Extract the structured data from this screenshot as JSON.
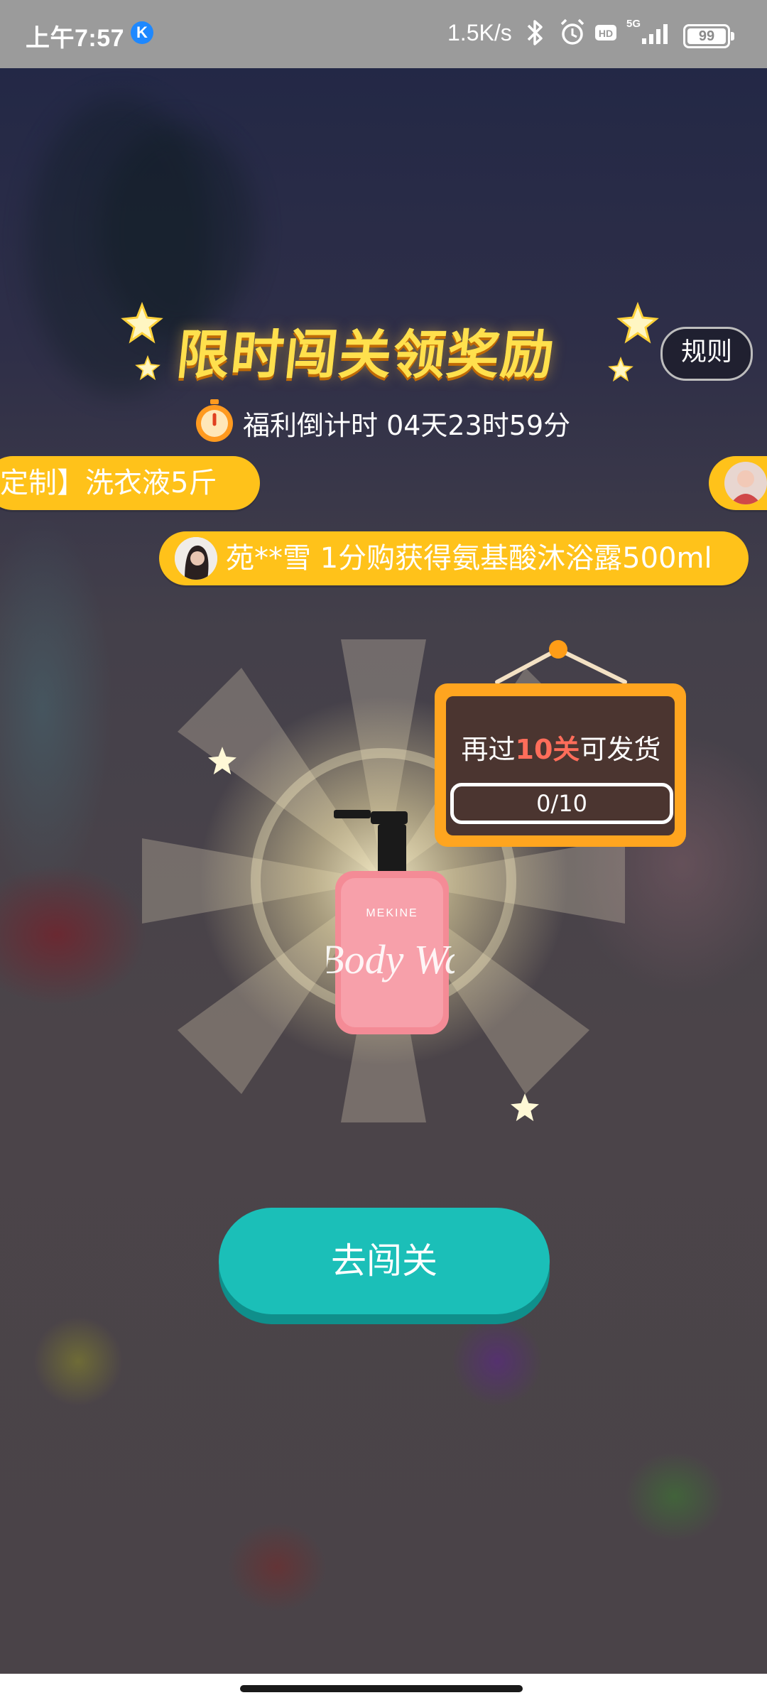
{
  "status_bar": {
    "time": "上午7:57",
    "app_badge": "K",
    "network_speed": "1.5K/s",
    "network_type": "5G",
    "battery": "99",
    "icons": [
      "bluetooth-icon",
      "alarm-icon",
      "hd-icon",
      "signal-icon",
      "battery-icon"
    ]
  },
  "header": {
    "title": "限时闯关领奖励",
    "rules_label": "规则",
    "countdown_text": "福利倒计时 04天23时59分"
  },
  "marquee": {
    "item1": "定制】洗衣液5斤",
    "item2": "苑**雪 1分购获得氨基酸沐浴露500ml"
  },
  "reward": {
    "sign_prefix": "再过",
    "sign_highlight": "10关",
    "sign_suffix": "可发货",
    "progress_text": "0/10",
    "progress": 0,
    "bottle_brand": "MEKINE",
    "bottle_script": "Body Wa"
  },
  "actions": {
    "go_label": "去闯关"
  },
  "colors": {
    "title": "#ffe04d",
    "pill": "#ffc21a",
    "button": "#1bbfb8",
    "sign": "#ffa51f",
    "highlight": "#ff6d5a"
  }
}
